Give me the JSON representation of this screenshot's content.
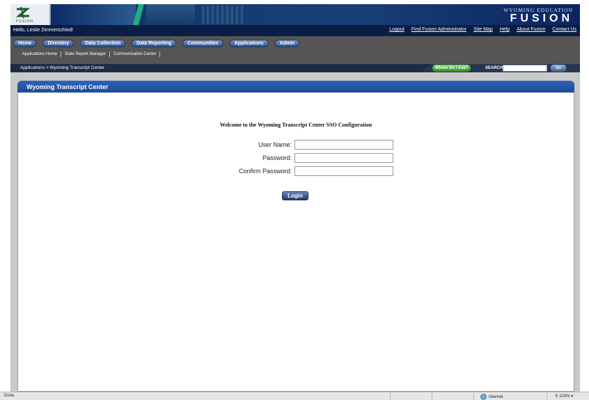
{
  "banner": {
    "logo_text": "FUSION",
    "brand_top": "WYOMING EDUCATION",
    "brand_main": "FUSION"
  },
  "userbar": {
    "greeting": "Hello, Leslie Zimmerschied!",
    "links": [
      "Logout",
      "Find Fusion Administrator",
      "Site Map",
      "Help",
      "About Fusion",
      "Contact Us"
    ]
  },
  "nav": {
    "buttons": [
      "Home",
      "Directory",
      "Data Collection",
      "Data Reporting",
      "Communities",
      "Applications",
      "Admin"
    ],
    "subnav": [
      "Applications Home",
      "State Report Manager",
      "Communication Center"
    ]
  },
  "breadcrumb": "Applications > Wyoming Transcript Center",
  "search": {
    "whom_label": "Whom Do I Ask?",
    "label": "SEARCH",
    "value": "",
    "go_label": "Go"
  },
  "panel": {
    "title": "Wyoming Transcript Center",
    "welcome": "Welcome to the Wyoming Transcript Center SSO Configuration",
    "fields": {
      "username_label": "User Name:",
      "username_value": "",
      "password_label": "Password:",
      "password_value": "",
      "confirm_label": "Confirm Password:",
      "confirm_value": ""
    },
    "login_label": "Login"
  },
  "status": {
    "left": "Done",
    "zone": "Internet",
    "zoom": "100%"
  },
  "colors": {
    "banner": "#0c2a66",
    "nav_bg": "#555555",
    "panel_title": "#1b4a98",
    "whom_button": "#2f8c22"
  }
}
